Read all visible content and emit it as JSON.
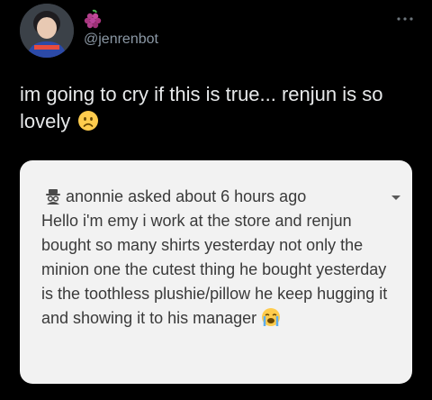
{
  "tweet": {
    "handle": "@jenrenbot",
    "name_emoji_icon": "grapes-icon",
    "text": "im going to cry if this is true... renjun is so lovely",
    "text_emoji_icon": "frowning-face-icon"
  },
  "card": {
    "header": "anonnie asked about 6 hours ago",
    "header_icon": "spy-icon",
    "body": "Hello i'm emy i work at the store and renjun bought so many shirts yesterday not only the minion one the cutest thing he bought yesterday is the toothless plushie/pillow he keep hugging it and showing it to his manager",
    "body_emoji_icon": "loudly-crying-face-icon"
  },
  "colors": {
    "background": "#000000",
    "text": "#e7e9ea",
    "secondary_text": "#8b98a5",
    "card_background": "#f2f2f2",
    "card_text": "#3a3a3a"
  }
}
